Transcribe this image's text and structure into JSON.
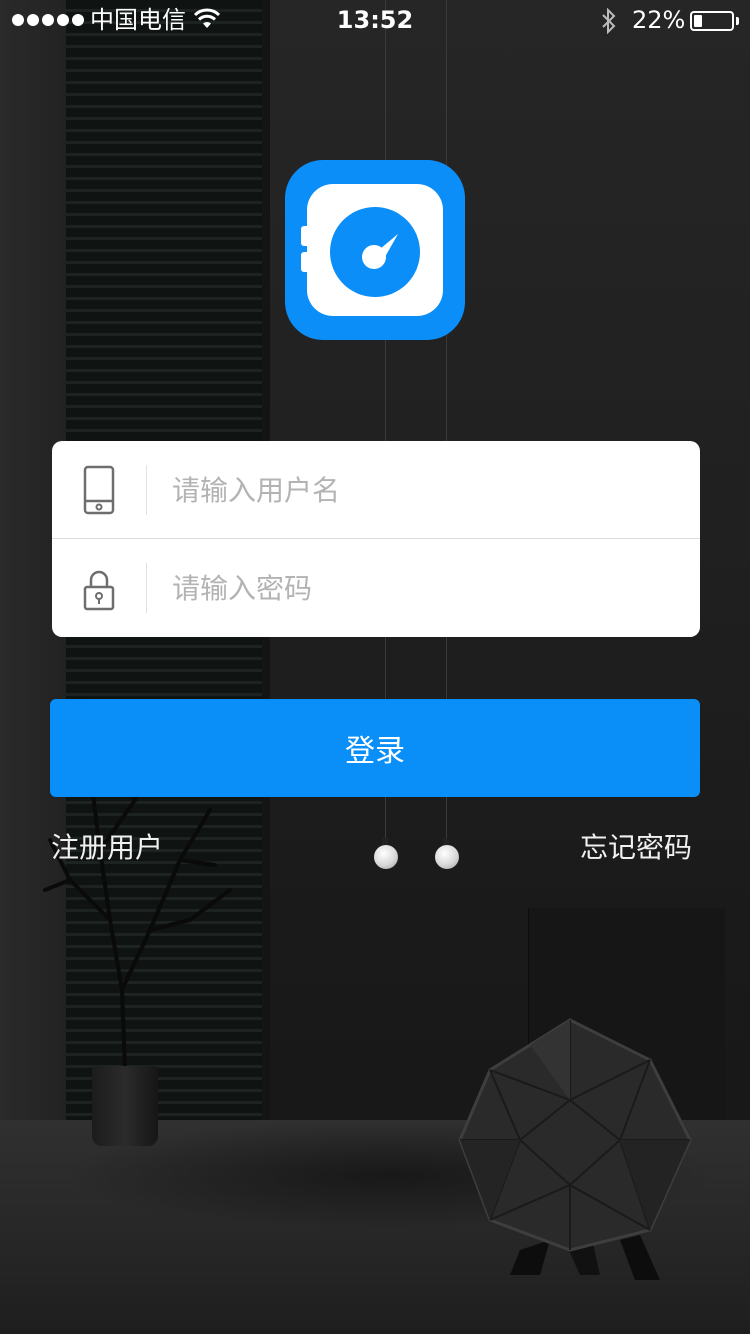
{
  "status_bar": {
    "carrier": "中国电信",
    "time": "13:52",
    "battery_percent": "22%",
    "battery_level": 0.22,
    "signal_bars": 5
  },
  "app": {
    "logo_icon": "compass-gauge-icon",
    "brand_color": "#0b8ef7"
  },
  "login_form": {
    "username": {
      "placeholder": "请输入用户名",
      "value": "",
      "icon": "phone-icon"
    },
    "password": {
      "placeholder": "请输入密码",
      "value": "",
      "icon": "lock-icon"
    },
    "submit_label": "登录",
    "register_label": "注册用户",
    "forgot_label": "忘记密码"
  }
}
